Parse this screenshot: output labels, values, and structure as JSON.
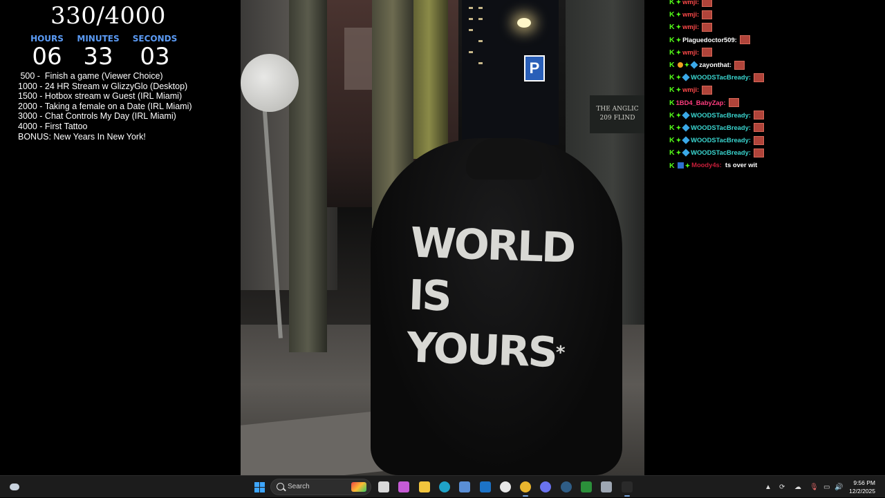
{
  "overlay": {
    "sub_counter": "330/4000",
    "timer": {
      "hours_label": "HOURS",
      "hours": "06",
      "minutes_label": "MINUTES",
      "minutes": "33",
      "seconds_label": "SECONDS",
      "seconds": "03"
    },
    "goals": [
      " 500 -  Finish a game (Viewer Choice)",
      "1000 - 24 HR Stream w GlizzyGlo (Desktop)",
      "1500 - Hotbox stream w Guest (IRL Miami)",
      "2000 - Taking a female on a Date (IRL Miami)",
      "3000 - Chat Controls My Day (IRL Miami)",
      "4000 - First Tattoo",
      "BONUS: New Years In New York!"
    ]
  },
  "video": {
    "hoodie_line1": "WORLD",
    "hoodie_line2": "IS",
    "hoodie_line3": "YOURS",
    "hoodie_star": "*",
    "sign_line1": "THE ANGLIC",
    "sign_line2": "209 FLIND",
    "parking": "P"
  },
  "chat": {
    "messages": [
      {
        "user": "wmji:",
        "color": "#ff4a4a",
        "badges": [
          "k",
          "s"
        ],
        "emote": true,
        "text": ""
      },
      {
        "user": "wmji:",
        "color": "#ff4a4a",
        "badges": [
          "k",
          "s"
        ],
        "emote": true,
        "text": ""
      },
      {
        "user": "wmji:",
        "color": "#ff4a4a",
        "badges": [
          "k",
          "s"
        ],
        "emote": true,
        "text": ""
      },
      {
        "user": "Plaguedoctor509:",
        "color": "#ffffff",
        "badges": [
          "k",
          "s"
        ],
        "emote": true,
        "text": ""
      },
      {
        "user": "wmji:",
        "color": "#ff4a4a",
        "badges": [
          "k",
          "s"
        ],
        "emote": true,
        "text": ""
      },
      {
        "user": "zayonthat:",
        "color": "#ffffff",
        "badges": [
          "k",
          "c",
          "s",
          "g"
        ],
        "emote": true,
        "text": ""
      },
      {
        "user": "WOODSTacBready:",
        "color": "#3ad6d0",
        "badges": [
          "k",
          "s",
          "g"
        ],
        "emote": true,
        "text": ""
      },
      {
        "user": "wmji:",
        "color": "#ff4a4a",
        "badges": [
          "k",
          "s"
        ],
        "emote": true,
        "text": ""
      },
      {
        "user": "1BD4_BabyZap:",
        "color": "#ff3d7f",
        "badges": [
          "k"
        ],
        "emote": true,
        "text": ""
      },
      {
        "user": "WOODSTacBready:",
        "color": "#3ad6d0",
        "badges": [
          "k",
          "s",
          "g"
        ],
        "emote": true,
        "text": ""
      },
      {
        "user": "WOODSTacBready:",
        "color": "#3ad6d0",
        "badges": [
          "k",
          "s",
          "g"
        ],
        "emote": true,
        "text": ""
      },
      {
        "user": "WOODSTacBready:",
        "color": "#3ad6d0",
        "badges": [
          "k",
          "s",
          "g"
        ],
        "emote": true,
        "text": ""
      },
      {
        "user": "WOODSTacBready:",
        "color": "#3ad6d0",
        "badges": [
          "k",
          "s",
          "g"
        ],
        "emote": true,
        "text": ""
      },
      {
        "user": "Moody4s:",
        "color": "#c81e3a",
        "badges": [
          "k",
          "b",
          "s"
        ],
        "emote": false,
        "text": "ts over wit"
      }
    ]
  },
  "taskbar": {
    "search_label": "Search",
    "time": "9:56 PM",
    "date": "12/2/2025",
    "apps": [
      {
        "name": "task-view-icon",
        "color": "#d8d8d8"
      },
      {
        "name": "copilot-icon",
        "color": "#c65bd6"
      },
      {
        "name": "file-explorer-icon",
        "color": "#f2c53d"
      },
      {
        "name": "edge-icon",
        "color": "#1fa2c8"
      },
      {
        "name": "store-icon",
        "color": "#5a8fd6"
      },
      {
        "name": "outlook-icon",
        "color": "#1c73c7"
      },
      {
        "name": "github-icon",
        "color": "#e8e8e8"
      },
      {
        "name": "chrome-icon",
        "color": "#e9b62e"
      },
      {
        "name": "discord-icon",
        "color": "#6a73f0"
      },
      {
        "name": "steam-icon",
        "color": "#2f5d86"
      },
      {
        "name": "xbox-icon",
        "color": "#2b8f3a"
      },
      {
        "name": "settings-icon",
        "color": "#9ea7b3"
      },
      {
        "name": "epic-games-icon",
        "color": "#2a2a2a"
      }
    ]
  }
}
